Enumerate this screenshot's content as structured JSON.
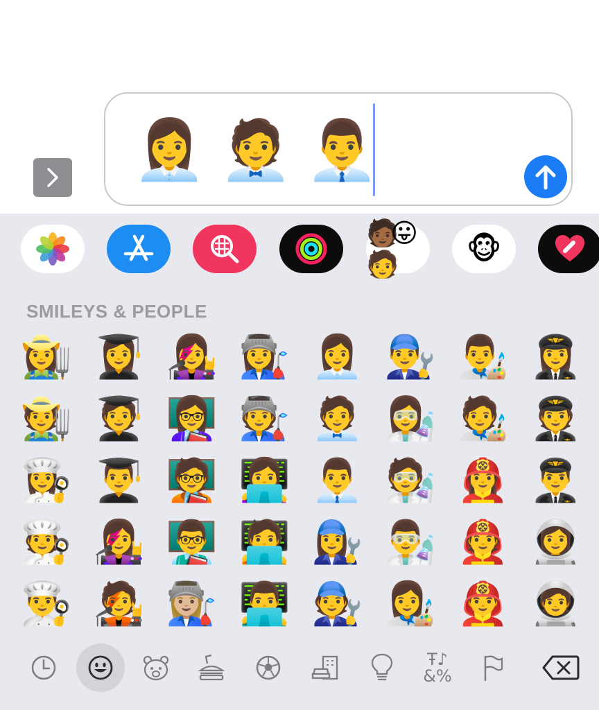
{
  "message": {
    "text": "👩‍💼🧑‍💼👨‍💼",
    "expand_icon": "chevron-right-icon",
    "send_icon": "arrow-up-icon",
    "send_color": "#1b7cf5"
  },
  "app_drawer": [
    {
      "name": "photos-app",
      "icon": "photos-flower-icon",
      "bg": "#ffffff"
    },
    {
      "name": "app-store",
      "icon": "app-store-icon",
      "bg": "#1d8df2"
    },
    {
      "name": "image-search",
      "icon": "globe-search-icon",
      "bg": "#f0365f"
    },
    {
      "name": "fitness-activity",
      "icon": "activity-rings-icon",
      "bg": "#0c0c0c"
    },
    {
      "name": "memoji-stickers",
      "icon": "memoji-group-icon",
      "bg": "#ffffff"
    },
    {
      "name": "animoji",
      "icon": "monkey-icon",
      "bg": "#ffffff"
    },
    {
      "name": "digital-touch",
      "icon": "heart-touch-icon",
      "bg": "#0c0c0c"
    }
  ],
  "emoji_section": {
    "title": "SMILEYS & PEOPLE",
    "emojis": [
      "👩‍🌾",
      "👩‍🎓",
      "👩‍🎤",
      "👩‍🏭",
      "👩‍💼",
      "👨‍🔧",
      "👨‍🎨",
      "👩‍✈️",
      "🧑‍🌾",
      "🧑‍🎓",
      "👩‍🏫",
      "🧑‍🏭",
      "🧑‍💼",
      "👩‍🔬",
      "🧑‍🎨",
      "🧑‍✈️",
      "👩‍🍳",
      "👨‍🎓",
      "🧑‍🏫",
      "👩‍💻",
      "👨‍💼",
      "🧑‍🔬",
      "👩‍🚒",
      "👨‍✈️",
      "🧑‍🍳",
      "👩‍🎤",
      "👨‍🏫",
      "🧑‍💻",
      "👩‍🔧",
      "👨‍🔬",
      "🧑‍🚒",
      "👩‍🚀",
      "👨‍🍳",
      "🧑‍🎤",
      "👩🏼‍🏭",
      "👨‍💻",
      "🧑‍🔧",
      "👩‍🎨",
      "👨‍🚒",
      "🧑‍🚀"
    ]
  },
  "categories": [
    {
      "name": "recent",
      "icon": "clock-icon",
      "active": false
    },
    {
      "name": "smileys-people",
      "icon": "smiley-icon",
      "active": true
    },
    {
      "name": "animals-nature",
      "icon": "bear-icon",
      "active": false
    },
    {
      "name": "food-drink",
      "icon": "burger-icon",
      "active": false
    },
    {
      "name": "activity",
      "icon": "soccer-ball-icon",
      "active": false
    },
    {
      "name": "travel-places",
      "icon": "car-building-icon",
      "active": false
    },
    {
      "name": "objects",
      "icon": "lightbulb-icon",
      "active": false
    },
    {
      "name": "symbols",
      "icon": "symbols-icon",
      "label": "Ŧ♪\n&%",
      "active": false
    },
    {
      "name": "flags",
      "icon": "flag-icon",
      "active": false
    },
    {
      "name": "delete",
      "icon": "backspace-icon",
      "active": false
    }
  ]
}
